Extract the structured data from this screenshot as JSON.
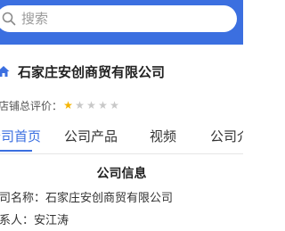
{
  "search": {
    "placeholder": "搜索",
    "icon": "search-icon"
  },
  "shop": {
    "icon": "home-icon",
    "name": "石家庄安创商贸有限公司"
  },
  "rating": {
    "label": "店铺总评价：",
    "filled_stars": 1,
    "total_stars": 5,
    "star_filled_color": "#f5b400",
    "star_empty_color": "#c8c8c8"
  },
  "tabs": [
    {
      "label": "公司首页",
      "active": true
    },
    {
      "label": "公司产品",
      "active": false
    },
    {
      "label": "视频",
      "active": false
    },
    {
      "label": "公司介绍",
      "active": false
    }
  ],
  "company_info": {
    "title": "公司信息",
    "rows": [
      {
        "text": "公司名称：石家庄安创商贸有限公司"
      },
      {
        "text": "联系人：安江涛"
      }
    ]
  },
  "colors": {
    "brand": "#3b6fe0",
    "text": "#333333"
  }
}
